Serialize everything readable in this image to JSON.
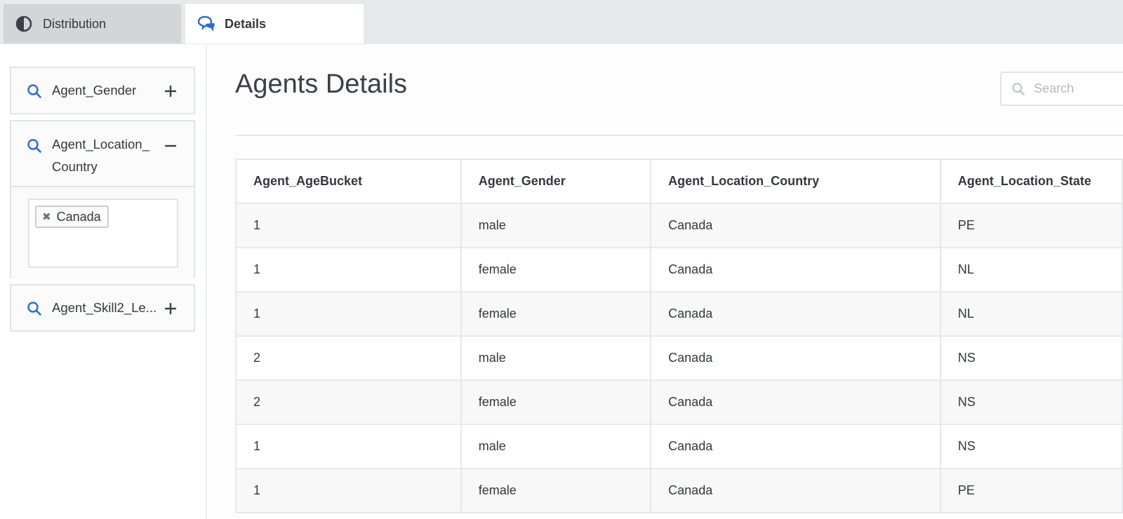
{
  "tabs": [
    {
      "label": "Distribution",
      "icon": "half-circle-icon",
      "active": false
    },
    {
      "label": "Details",
      "icon": "chat-bubbles-icon",
      "active": true
    }
  ],
  "facets": [
    {
      "label": "Agent_Gender",
      "expanded": false
    },
    {
      "label": "Agent_Location_ Country",
      "expanded": true,
      "selected": [
        "Canada"
      ]
    },
    {
      "label": "Agent_Skill2_Le...",
      "expanded": false
    }
  ],
  "main": {
    "title": "Agents Details",
    "search_placeholder": "Search"
  },
  "table": {
    "headers": [
      "Agent_AgeBucket",
      "Agent_Gender",
      "Agent_Location_Country",
      "Agent_Location_State"
    ],
    "rows": [
      [
        "1",
        "male",
        "Canada",
        "PE"
      ],
      [
        "1",
        "female",
        "Canada",
        "NL"
      ],
      [
        "1",
        "female",
        "Canada",
        "NL"
      ],
      [
        "2",
        "male",
        "Canada",
        "NS"
      ],
      [
        "2",
        "female",
        "Canada",
        "NS"
      ],
      [
        "1",
        "male",
        "Canada",
        "NS"
      ],
      [
        "1",
        "female",
        "Canada",
        "PE"
      ]
    ]
  },
  "colors": {
    "accent": "#2a6ccf",
    "text": "#33383f"
  }
}
